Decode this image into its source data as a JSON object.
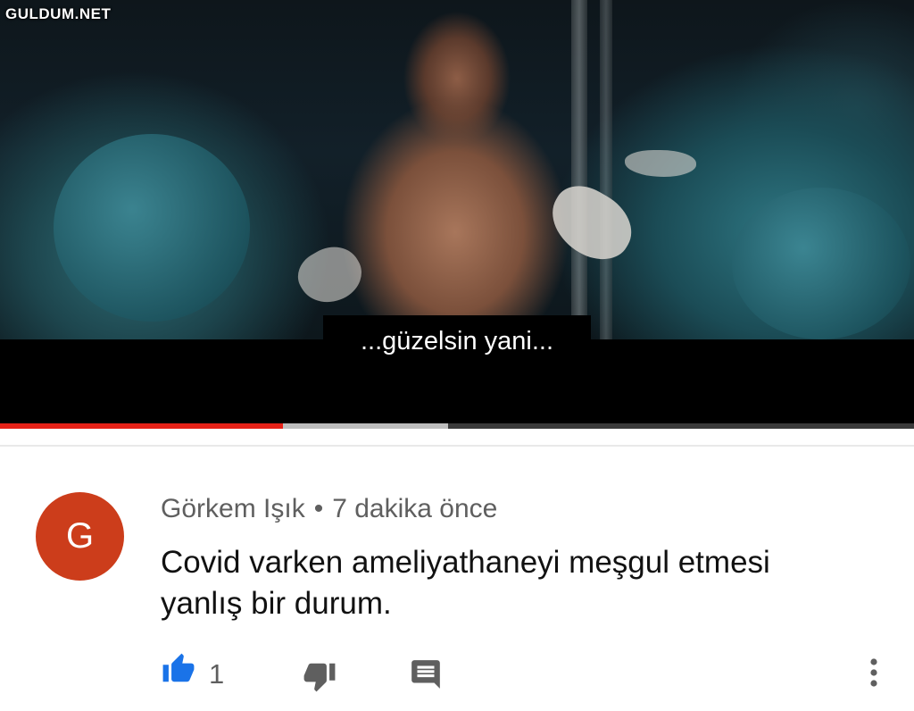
{
  "watermark": "GULDUM.NET",
  "video": {
    "subtitle": "...güzelsin yani...",
    "progress_played_fraction": 0.31,
    "progress_buffered_fraction": 0.49
  },
  "comment": {
    "avatar_letter": "G",
    "author": "Görkem Işık",
    "separator": "•",
    "time": "7 dakika önce",
    "text_line1": "Covid varken ameliyathaneyi meşgul etmesi",
    "text_line2": "yanlış bir durum.",
    "like_count": "1"
  },
  "colors": {
    "avatar_bg": "#cc3d1b",
    "like_icon": "#1a73e8",
    "progress_played": "#e62117",
    "secondary_text": "#5f5f5f"
  },
  "icons": [
    "thumbs-up-icon",
    "thumbs-down-icon",
    "reply-icon",
    "more-vert-icon"
  ]
}
